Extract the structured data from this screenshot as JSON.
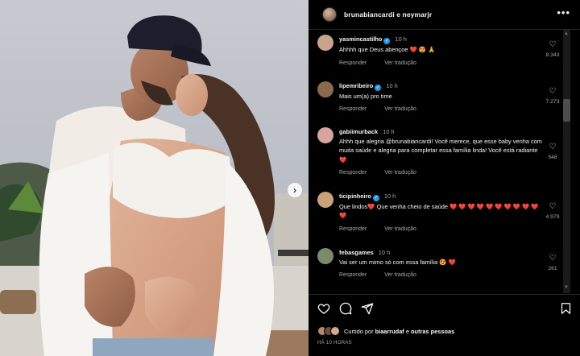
{
  "post": {
    "header_title": "brunabiancardi e neymarjr",
    "more_icon": "more-horizontal-icon",
    "next_icon": "chevron-right-icon"
  },
  "comments": [
    {
      "user": "yasmincastilho",
      "verified": true,
      "time": "10 h",
      "text": "Ahhhh que Deus abençoe ❤️ 😍 🙏",
      "likes": "8.343",
      "reply": "Responder",
      "translate": "Ver tradução",
      "avatar_color": "#c9a38c"
    },
    {
      "user": "lipemribeiro",
      "verified": true,
      "time": "10 h",
      "text": "Mais um(a) pro time",
      "likes": "7.273",
      "reply": "Responder",
      "translate": "Ver tradução",
      "avatar_color": "#8a6a4f"
    },
    {
      "user": "gabiimurback",
      "verified": false,
      "time": "10 h",
      "text": "Ahhh que alegria @brunabiancardi! Você merece, que esse baby venha com muita saúde e alegria para completar essa família linda! Você está radiante ❤️",
      "likes": "548",
      "reply": "Responder",
      "translate": "Ver tradução",
      "avatar_color": "#d8a4a0"
    },
    {
      "user": "ticipinheiro",
      "verified": true,
      "time": "10 h",
      "text": "Que lindos❤️ Que venha cheio de saúde ❤️ ❤️ ❤️ ❤️ ❤️ ❤️ ❤️ ❤️ ❤️ ❤️ ❤️",
      "likes": "4.979",
      "reply": "Responder",
      "translate": "Ver tradução",
      "avatar_color": "#caa27a"
    },
    {
      "user": "febasgames",
      "verified": false,
      "time": "10 h",
      "text": "Vai ser um mimo só com essa família 😍 ❤️",
      "likes": "261",
      "reply": "Responder",
      "translate": "Ver tradução",
      "avatar_color": "#7b8a6c"
    }
  ],
  "footer": {
    "icons": [
      "heart-icon",
      "comment-icon",
      "share-icon",
      "bookmark-icon"
    ],
    "liked_prefix": "Curtido por",
    "liked_user": "biaarrudaf",
    "liked_conj": "e",
    "liked_others": "outras pessoas",
    "time_ago": "HÁ 10 HORAS"
  }
}
